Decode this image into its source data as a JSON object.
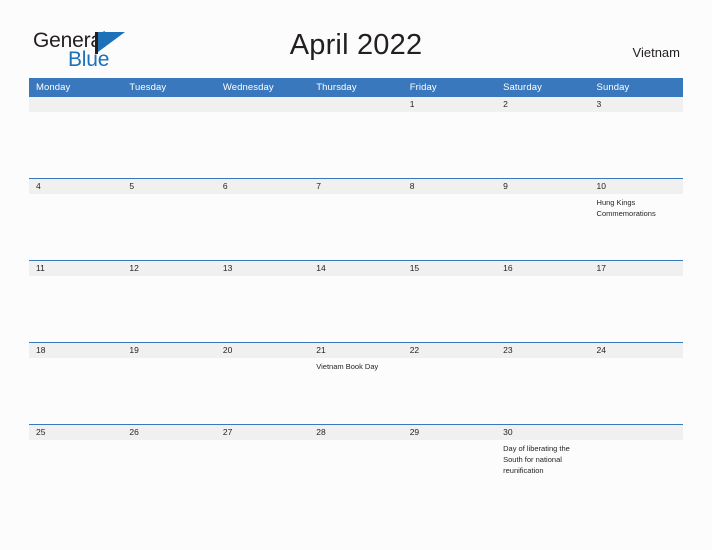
{
  "brand": {
    "name_top": "General",
    "name_bottom": "Blue",
    "accent_color": "#1c71b8"
  },
  "header": {
    "title": "April 2022",
    "country": "Vietnam"
  },
  "calendar": {
    "header_color": "#3a78be",
    "date_band_color": "#f0f0f0",
    "weekdays": [
      "Monday",
      "Tuesday",
      "Wednesday",
      "Thursday",
      "Friday",
      "Saturday",
      "Sunday"
    ],
    "weeks": [
      {
        "days": [
          {
            "date": "",
            "event": ""
          },
          {
            "date": "",
            "event": ""
          },
          {
            "date": "",
            "event": ""
          },
          {
            "date": "",
            "event": ""
          },
          {
            "date": "1",
            "event": ""
          },
          {
            "date": "2",
            "event": ""
          },
          {
            "date": "3",
            "event": ""
          }
        ]
      },
      {
        "days": [
          {
            "date": "4",
            "event": ""
          },
          {
            "date": "5",
            "event": ""
          },
          {
            "date": "6",
            "event": ""
          },
          {
            "date": "7",
            "event": ""
          },
          {
            "date": "8",
            "event": ""
          },
          {
            "date": "9",
            "event": ""
          },
          {
            "date": "10",
            "event": "Hung Kings Commemorations"
          }
        ]
      },
      {
        "days": [
          {
            "date": "11",
            "event": ""
          },
          {
            "date": "12",
            "event": ""
          },
          {
            "date": "13",
            "event": ""
          },
          {
            "date": "14",
            "event": ""
          },
          {
            "date": "15",
            "event": ""
          },
          {
            "date": "16",
            "event": ""
          },
          {
            "date": "17",
            "event": ""
          }
        ]
      },
      {
        "days": [
          {
            "date": "18",
            "event": ""
          },
          {
            "date": "19",
            "event": ""
          },
          {
            "date": "20",
            "event": ""
          },
          {
            "date": "21",
            "event": "Vietnam Book Day"
          },
          {
            "date": "22",
            "event": ""
          },
          {
            "date": "23",
            "event": ""
          },
          {
            "date": "24",
            "event": ""
          }
        ]
      },
      {
        "days": [
          {
            "date": "25",
            "event": ""
          },
          {
            "date": "26",
            "event": ""
          },
          {
            "date": "27",
            "event": ""
          },
          {
            "date": "28",
            "event": ""
          },
          {
            "date": "29",
            "event": ""
          },
          {
            "date": "30",
            "event": "Day of liberating the South for national reunification"
          },
          {
            "date": "",
            "event": ""
          }
        ]
      }
    ]
  }
}
